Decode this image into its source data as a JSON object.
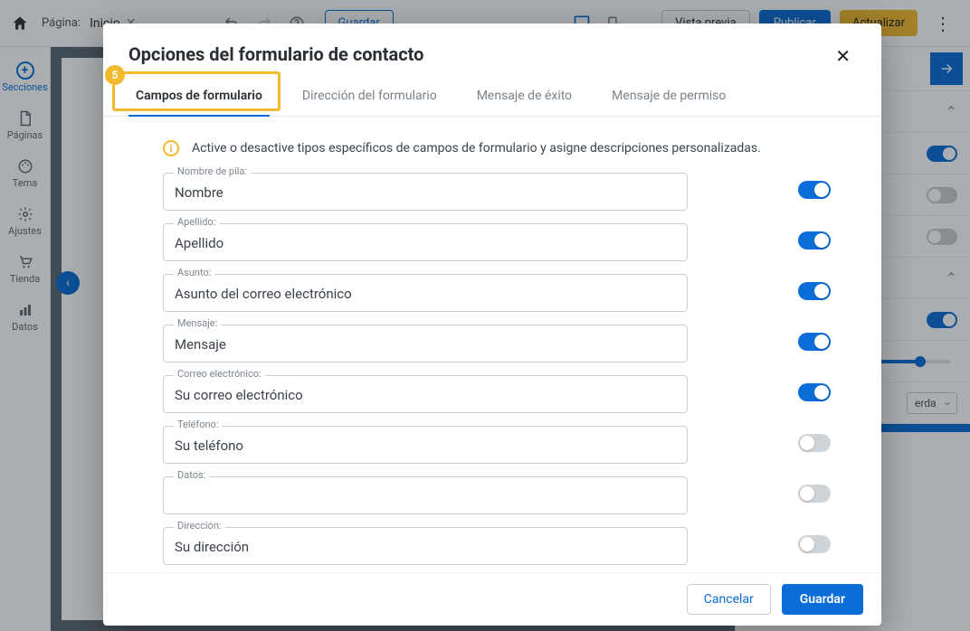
{
  "top": {
    "page_label": "Página:",
    "page_name": "Inicio",
    "save_label": "Guardar",
    "preview_label": "Vista previa",
    "publish_label": "Publicar",
    "update_label": "Actualizar"
  },
  "sidebar": {
    "items": [
      {
        "label": "Secciones"
      },
      {
        "label": "Páginas"
      },
      {
        "label": "Tema"
      },
      {
        "label": "Ajustes"
      },
      {
        "label": "Tienda"
      },
      {
        "label": "Datos"
      }
    ]
  },
  "right_panel": {
    "select_value": "erda"
  },
  "annotation": {
    "step": "5"
  },
  "modal": {
    "title": "Opciones del formulario de contacto",
    "tabs": [
      {
        "label": "Campos de formulario",
        "active": true
      },
      {
        "label": "Dirección del formulario"
      },
      {
        "label": "Mensaje de éxito"
      },
      {
        "label": "Mensaje de permiso"
      }
    ],
    "info": "Active o desactive tipos específicos de campos de formulario y asigne descripciones personalizadas.",
    "fields": [
      {
        "label": "Nombre de pila:",
        "value": "Nombre",
        "on": true
      },
      {
        "label": "Apellido:",
        "value": "Apellido",
        "on": true
      },
      {
        "label": "Asunto:",
        "value": "Asunto del correo electrónico",
        "on": true
      },
      {
        "label": "Mensaje:",
        "value": "Mensaje",
        "on": true
      },
      {
        "label": "Correo electrónico:",
        "value": "Su correo electrónico",
        "on": true
      },
      {
        "label": "Teléfono:",
        "value": "Su teléfono",
        "on": false
      },
      {
        "label": "Datos:",
        "value": "",
        "on": false
      },
      {
        "label": "Dirección:",
        "value": "Su dirección",
        "on": false
      }
    ],
    "cancel_label": "Cancelar",
    "save_label": "Guardar"
  }
}
